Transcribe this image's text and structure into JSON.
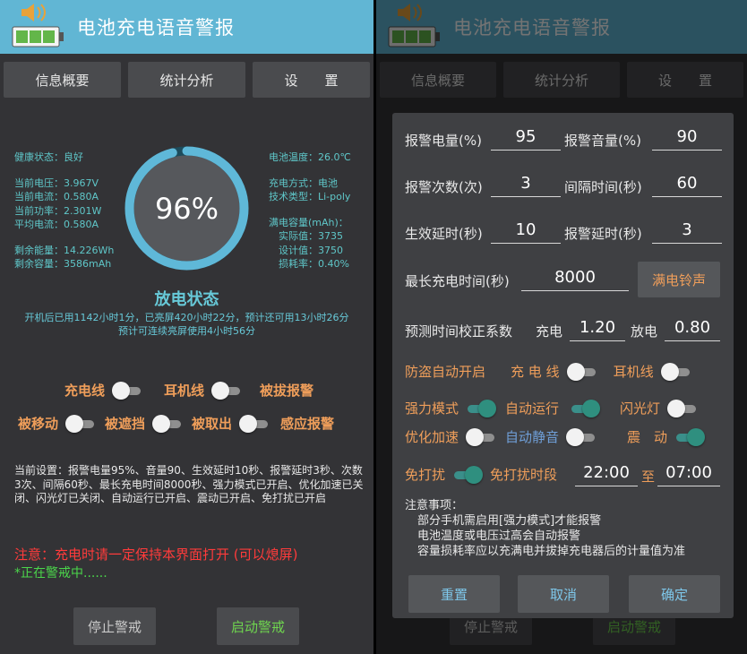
{
  "app": {
    "title": "电池充电语音警报"
  },
  "tabs": [
    "信息概要",
    "统计分析",
    "设　　置"
  ],
  "left": {
    "info_left": [
      {
        "label": "健康状态：",
        "value": "良好"
      },
      {
        "label": "当前电压：",
        "value": "3.967V"
      },
      {
        "label": "当前电流：",
        "value": "0.580A"
      },
      {
        "label": "当前功率：",
        "value": "2.301W"
      },
      {
        "label": "平均电流：",
        "value": "0.580A"
      },
      {
        "label": "剩余能量：",
        "value": "14.226Wh"
      },
      {
        "label": "剩余容量：",
        "value": "3586mAh"
      }
    ],
    "info_right": {
      "temp": "电池温度：26.0℃",
      "charge_mode": "充电方式：电池",
      "tech": "技术类型：Li-poly",
      "cap_title": "满电容量(mAh)：",
      "actual": "实际值：3735",
      "design": "设计值：3750",
      "loss": "损耗率：0.40%"
    },
    "battery_percent": "96%",
    "battery_level": 0.96,
    "state": "放电状态",
    "state_line1": "开机后已用1142小时1分，已亮屏420小时22分，预计还可用13小时26分",
    "state_line2": "预计可连续亮屏使用4小时56分",
    "switches": {
      "charge_cable": "充电线",
      "headphone": "耳机线",
      "unplug": "被拔报警",
      "moved": "被移动",
      "covered": "被遮挡",
      "taken": "被取出",
      "sensor": "感应报警"
    },
    "current_settings": "当前设置：报警电量95%、音量90、生效延时10秒、报警延时3秒、次数3次、间隔60秒、最长充电时间8000秒、强力模式已开启、优化加速已关闭、闪光灯已关闭、自动运行已开启、震动已开启、免打扰已开启",
    "warning": "注意：充电时请一定保持本界面打开 (可以熄屏)",
    "alerting": "*正在警戒中......",
    "stop_button": "停止警戒",
    "start_button": "启动警戒"
  },
  "dialog": {
    "alarm_level_label": "报警电量(%)",
    "alarm_level": "95",
    "volume_label": "报警音量(%)",
    "volume": "90",
    "count_label": "报警次数(次)",
    "count": "3",
    "interval_label": "间隔时间(秒)",
    "interval": "60",
    "effect_delay_label": "生效延时(秒)",
    "effect_delay": "10",
    "alarm_delay_label": "报警延时(秒)",
    "alarm_delay": "3",
    "max_charge_label": "最长充电时间(秒)",
    "max_charge": "8000",
    "ringtone_button": "满电铃声",
    "correction_label": "预测时间校正系数",
    "charge_label": "充电",
    "charge_coef": "1.20",
    "discharge_label": "放电",
    "discharge_coef": "0.80",
    "anti_theft_label": "防盗自动开启",
    "cable_label": "充 电 线",
    "headphone_label": "耳机线",
    "power_mode": "强力模式",
    "auto_run": "自动运行",
    "flash": "闪光灯",
    "optimize": "优化加速",
    "auto_mute": "自动静音",
    "vibrate": "震　动",
    "dnd": "免打扰",
    "dnd_period": "免打扰时段",
    "dnd_start": "22:00",
    "to": "至",
    "dnd_end": "07:00",
    "notes_title": "注意事项：",
    "note1": "部分手机需启用[强力模式]才能报警",
    "note2": "电池温度或电压过高会自动报警",
    "note3": "容量损耗率应以充满电并拔掉充电器后的计量值为准",
    "reset": "重置",
    "cancel": "取消",
    "ok": "确定"
  },
  "colors": {
    "title_bar": "#61b6d4",
    "accent_teal": "#5fc7c9",
    "orange": "#ef9e5a",
    "warning_red": "#ff3b3b",
    "alert_green": "#4bd64b"
  }
}
